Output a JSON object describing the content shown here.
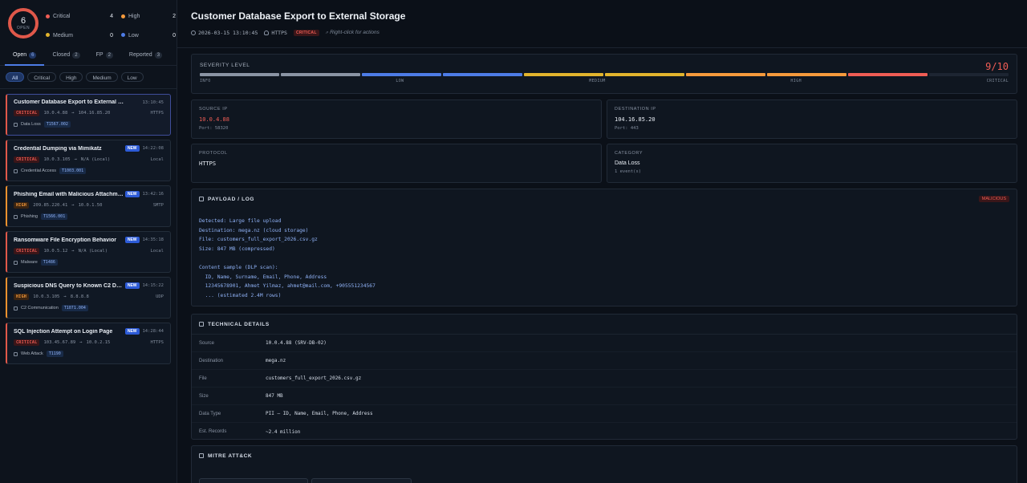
{
  "summary": {
    "open_count": "6",
    "open_label": "OPEN",
    "counts": [
      {
        "label": "Critical",
        "value": "4",
        "color": "#ef5d55"
      },
      {
        "label": "High",
        "value": "2",
        "color": "#f59a3c"
      },
      {
        "label": "Medium",
        "value": "0",
        "color": "#e2b42d"
      },
      {
        "label": "Low",
        "value": "0",
        "color": "#4d7ce6"
      }
    ]
  },
  "tabs": [
    {
      "label": "Open",
      "count": "6"
    },
    {
      "label": "Closed",
      "count": "2"
    },
    {
      "label": "FP",
      "count": "2"
    },
    {
      "label": "Reported",
      "count": "3"
    }
  ],
  "filters": [
    "All",
    "Critical",
    "High",
    "Medium",
    "Low"
  ],
  "alerts": [
    {
      "title": "Customer Database Export to External Storage",
      "new": "",
      "time": "13:10:45",
      "severity": "CRITICAL",
      "src": "10.0.4.88",
      "dst": "104.16.85.20",
      "protocol": "HTTPS",
      "category": "Data Loss",
      "mitre": "T1567.002"
    },
    {
      "title": "Credential Dumping via Mimikatz",
      "new": "NEW",
      "time": "14:22:08",
      "severity": "CRITICAL",
      "src": "10.0.3.105",
      "dst": "N/A (Local)",
      "protocol": "Local",
      "category": "Credential Access",
      "mitre": "T1003.001"
    },
    {
      "title": "Phishing Email with Malicious Attachment",
      "new": "NEW",
      "time": "13:42:16",
      "severity": "HIGH",
      "src": "209.85.220.41",
      "dst": "10.0.1.50",
      "protocol": "SMTP",
      "category": "Phishing",
      "mitre": "T1566.001"
    },
    {
      "title": "Ransomware File Encryption Behavior",
      "new": "NEW",
      "time": "14:35:18",
      "severity": "CRITICAL",
      "src": "10.0.5.12",
      "dst": "N/A (Local)",
      "protocol": "Local",
      "category": "Malware",
      "mitre": "T1486"
    },
    {
      "title": "Suspicious DNS Query to Known C2 Domain",
      "new": "NEW",
      "time": "14:15:22",
      "severity": "HIGH",
      "src": "10.0.3.105",
      "dst": "8.8.8.8",
      "protocol": "UDP",
      "category": "C2 Communication",
      "mitre": "T1071.004"
    },
    {
      "title": "SQL Injection Attempt on Login Page",
      "new": "NEW",
      "time": "14:28:44",
      "severity": "CRITICAL",
      "src": "103.45.67.89",
      "dst": "10.0.2.15",
      "protocol": "HTTPS",
      "category": "Web Attack",
      "mitre": "T1190"
    }
  ],
  "detail": {
    "title": "Customer Database Export to External Storage",
    "timestamp": "2026-03-15 13:10:45",
    "protocol": "HTTPS",
    "severity": "CRITICAL",
    "hint": "Right-click for actions",
    "severity_label": "SEVERITY LEVEL",
    "severity_score": "9/10",
    "severity_value": 9,
    "severity_max": 10,
    "severity_ticks": [
      "INFO",
      "LOW",
      "MEDIUM",
      "HIGH",
      "CRITICAL"
    ],
    "source_ip_label": "SOURCE IP",
    "source_ip": "10.0.4.88",
    "source_port": "Port: 58320",
    "dest_ip_label": "DESTINATION IP",
    "dest_ip": "104.16.85.20",
    "dest_port": "Port: 443",
    "protocol_label": "PROTOCOL",
    "protocol_value": "HTTPS",
    "category_label": "CATEGORY",
    "category_value": "Data Loss",
    "category_events": "1 event(s)",
    "payload_label": "PAYLOAD / LOG",
    "payload_tag": "MALICIOUS",
    "payload_lines": [
      "Detected: Large file upload",
      "Destination: mega.nz (cloud storage)",
      "File: customers_full_export_2026.csv.gz",
      "Size: 847 MB (compressed)",
      "",
      "Content sample (DLP scan):",
      "  ID, Name, Surname, Email, Phone, Address",
      "  12345678901, Ahmet Yilmaz, ahmet@mail.com, +905551234567",
      "  ... (estimated 2.4M rows)"
    ],
    "tech_label": "TECHNICAL DETAILS",
    "tech_rows": [
      {
        "k": "Source",
        "v": "10.0.4.88 (SRV-DB-02)"
      },
      {
        "k": "Destination",
        "v": "mega.nz"
      },
      {
        "k": "File",
        "v": "customers_full_export_2026.csv.gz"
      },
      {
        "k": "Size",
        "v": "847 MB"
      },
      {
        "k": "Data Type",
        "v": "PII — ID, Name, Email, Phone, Address"
      },
      {
        "k": "Est. Records",
        "v": "~2.4 million"
      }
    ],
    "mitre_label": "MITRE ATT&CK"
  },
  "colors": {
    "critical": "#ef5d55",
    "high": "#f59a3c",
    "medium": "#e2b42d",
    "low": "#4d7ce6",
    "info": "#8a94a4"
  }
}
